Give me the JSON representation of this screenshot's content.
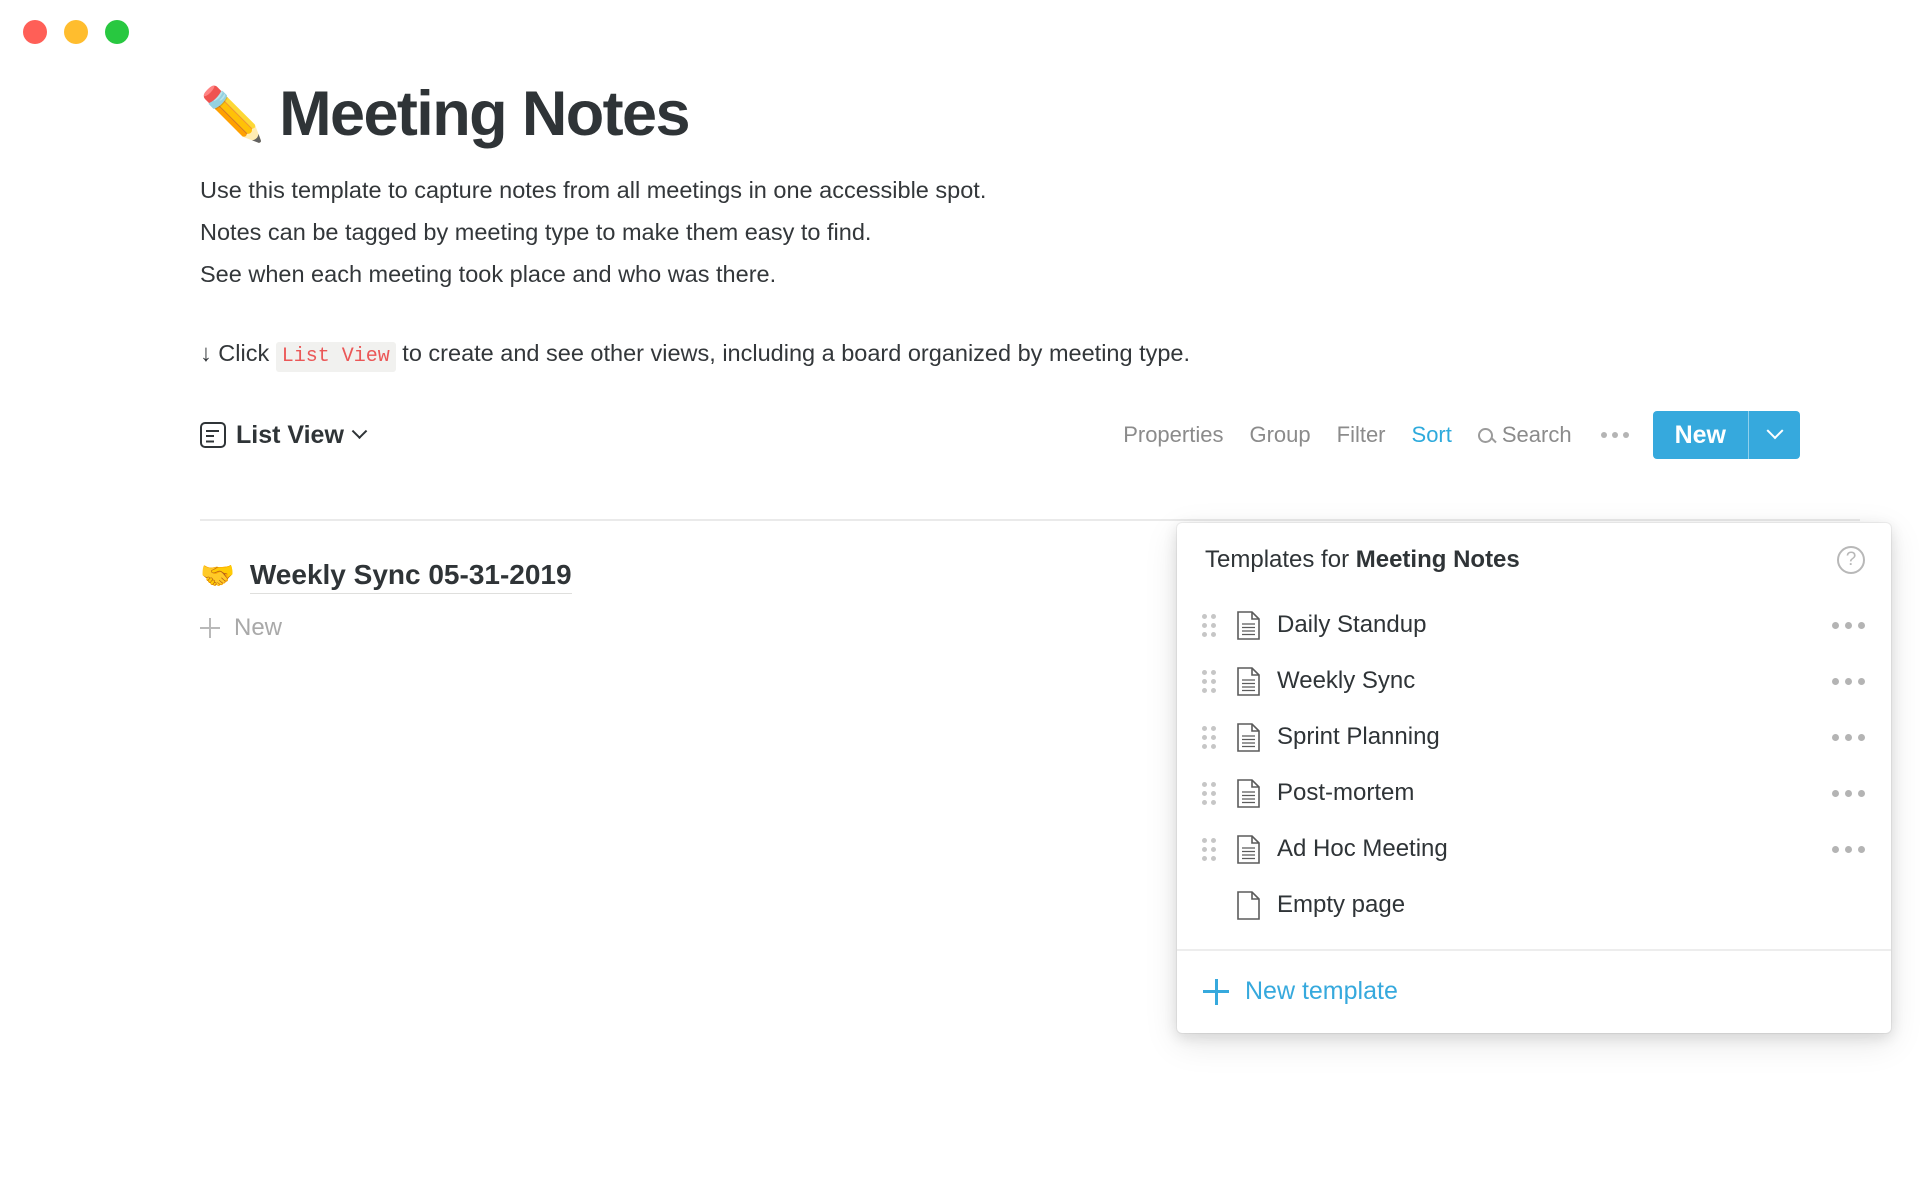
{
  "window": {
    "buttons": [
      {
        "name": "close",
        "color": "#ff5f57"
      },
      {
        "name": "minimize",
        "color": "#ffbd2e"
      },
      {
        "name": "maximize",
        "color": "#28c840"
      }
    ]
  },
  "page": {
    "emoji": "✏️",
    "title": "Meeting Notes",
    "description": [
      "Use this template to capture notes from all meetings in one accessible spot.",
      "Notes can be tagged by meeting type to make them easy to find.",
      "See when each meeting took place and who was there."
    ],
    "hint": {
      "prefix": "↓ Click",
      "code": "List View",
      "suffix": "to create and see other views, including a board organized by meeting type."
    }
  },
  "toolbar": {
    "view_name": "List View",
    "view_icon": "list-view-icon",
    "chevron_icon": "chevron-down-icon",
    "links": [
      {
        "label": "Properties",
        "active": false
      },
      {
        "label": "Group",
        "active": false
      },
      {
        "label": "Filter",
        "active": false
      },
      {
        "label": "Sort",
        "active": true
      }
    ],
    "search": {
      "icon": "search-icon",
      "label": "Search"
    },
    "more_icon": "ellipsis-icon",
    "new_label": "New",
    "new_caret_icon": "chevron-down-icon",
    "accent_color": "#36a9dd",
    "active_color": "#2eaadc"
  },
  "list": {
    "rows": [
      {
        "emoji": "🤝",
        "title": "Weekly Sync 05-31-2019"
      }
    ],
    "new_label": "New",
    "new_icon": "plus-icon"
  },
  "templates_popup": {
    "header": {
      "prefix": "Templates for ",
      "database": "Meeting Notes",
      "help_icon": "question-mark-icon",
      "help_glyph": "?"
    },
    "items": [
      {
        "label": "Daily Standup",
        "icon": "document-lines-icon",
        "draggable": true,
        "menu_icon": "ellipsis-icon"
      },
      {
        "label": "Weekly Sync",
        "icon": "document-lines-icon",
        "draggable": true,
        "menu_icon": "ellipsis-icon"
      },
      {
        "label": "Sprint Planning",
        "icon": "document-lines-icon",
        "draggable": true,
        "menu_icon": "ellipsis-icon"
      },
      {
        "label": "Post-mortem",
        "icon": "document-lines-icon",
        "draggable": true,
        "menu_icon": "ellipsis-icon"
      },
      {
        "label": "Ad Hoc Meeting",
        "icon": "document-lines-icon",
        "draggable": true,
        "menu_icon": "ellipsis-icon"
      },
      {
        "label": "Empty page",
        "icon": "document-blank-icon",
        "draggable": false,
        "menu_icon": null
      }
    ],
    "footer": {
      "icon": "plus-icon",
      "label": "New template"
    }
  }
}
